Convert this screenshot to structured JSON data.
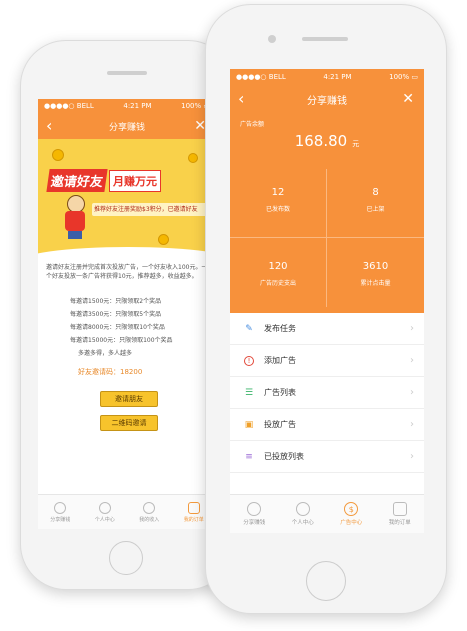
{
  "colors": {
    "accent": "#f7913b",
    "banner_yellow": "#f9d14a",
    "button_yellow": "#f7c32c",
    "highlight": "#e8892a"
  },
  "status": {
    "carrier": "BELL",
    "time": "4:21 PM",
    "battery": "100%",
    "wifi_icon": "wifi-icon"
  },
  "left_phone": {
    "nav": {
      "title": "分享赚钱",
      "back_icon": "back-arrow-icon",
      "close_icon": "close-icon"
    },
    "banner": {
      "headline_a": "邀请好友",
      "headline_b": "月赚万元",
      "subline": "推荐好友注册奖励$3积分，已邀请好友",
      "mascot_icon": "mascot-illustration"
    },
    "intro": "邀请好友注册并完成首次投放广告，一个好友收入100元。一个好友投放一条广告将获得10元，推荐越多，收益越多。",
    "rules": [
      "每邀请1500元：只限领取2个奖品",
      "每邀请3500元：只限领取5个奖品",
      "每邀请8000元：只限领取10个奖品",
      "每邀请15000元：只限领取100个奖品",
      "多邀多得，多人越多"
    ],
    "total_label": "好友邀请码",
    "total_value": "18200",
    "buttons": [
      "邀请朋友",
      "二维码邀请"
    ],
    "tabs": [
      {
        "label": "分享赚钱",
        "icon": "share-icon"
      },
      {
        "label": "个人中心",
        "icon": "person-icon"
      },
      {
        "label": "我的收入",
        "icon": "money-icon"
      },
      {
        "label": "我的订单",
        "icon": "bag-icon"
      }
    ],
    "active_tab": 3
  },
  "right_phone": {
    "nav": {
      "title": "分享赚钱",
      "back_icon": "back-arrow-icon",
      "close_icon": "close-icon"
    },
    "balance_label": "广告余额",
    "balance_value": "168.80",
    "balance_unit": "元",
    "stats": [
      {
        "value": "12",
        "label": "已发布数"
      },
      {
        "value": "8",
        "label": "已上架"
      },
      {
        "value": "120",
        "label": "广告历史支出"
      },
      {
        "value": "3610",
        "label": "累计点击量"
      }
    ],
    "menu": [
      {
        "label": "发布任务",
        "icon": "edit-icon",
        "color": "#4a8fe0"
      },
      {
        "label": "添加广告",
        "icon": "alert-icon",
        "color": "#e2483a"
      },
      {
        "label": "广告列表",
        "icon": "list-icon",
        "color": "#3ab36a"
      },
      {
        "label": "投放广告",
        "icon": "megaphone-icon",
        "color": "#f0a029"
      },
      {
        "label": "已投放列表",
        "icon": "stack-icon",
        "color": "#9b6bd6"
      }
    ],
    "tabs": [
      {
        "label": "分享赚钱",
        "icon": "share-icon"
      },
      {
        "label": "个人中心",
        "icon": "person-icon"
      },
      {
        "label": "广告中心",
        "icon": "dollar-icon"
      },
      {
        "label": "我的订单",
        "icon": "bag-icon"
      }
    ],
    "active_tab": 2
  }
}
